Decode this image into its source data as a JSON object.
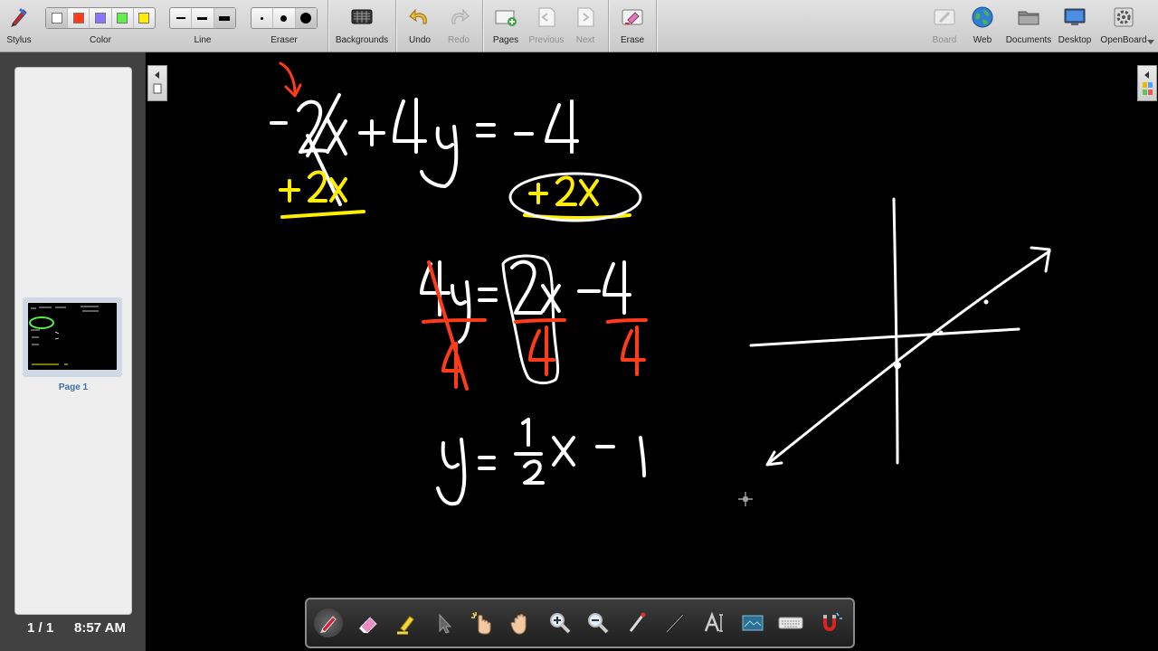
{
  "toolbar": {
    "stylus": "Stylus",
    "color": "Color",
    "line": "Line",
    "eraser": "Eraser",
    "backgrounds": "Backgrounds",
    "undo": "Undo",
    "redo": "Redo",
    "pages": "Pages",
    "previous": "Previous",
    "next": "Next",
    "erase": "Erase",
    "board": "Board",
    "web": "Web",
    "documents": "Documents",
    "desktop": "Desktop",
    "openboard": "OpenBoard"
  },
  "colors": {
    "palette": [
      "#ffffff",
      "#ff3b1a",
      "#8b73ff",
      "#5ff04a",
      "#ffee00"
    ],
    "ink_white": "#ffffff",
    "ink_yellow": "#ffee00",
    "ink_red": "#ff3b1a",
    "ink_green": "#55ee44"
  },
  "pages_panel": {
    "page_label": "Page 1",
    "page_count": "1 / 1",
    "clock": "8:57 AM"
  },
  "stylus_palette": [
    "pen-icon",
    "eraser-icon",
    "highlighter-icon",
    "selector-icon",
    "interactor-icon",
    "hand-icon",
    "zoom-in-icon",
    "zoom-out-icon",
    "laser-pointer-icon",
    "line-icon",
    "text-icon",
    "capture-icon",
    "keyboard-icon",
    "magnet-icon"
  ]
}
